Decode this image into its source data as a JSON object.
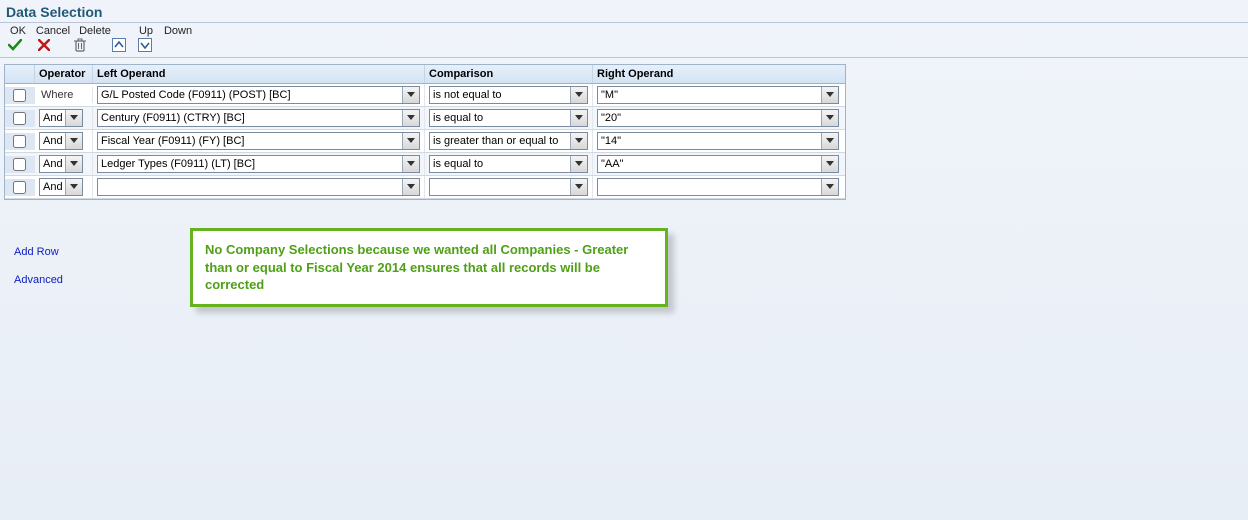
{
  "title": "Data Selection",
  "toolbar": {
    "ok": "OK",
    "cancel": "Cancel",
    "delete": "Delete",
    "up": "Up",
    "down": "Down"
  },
  "headers": {
    "operator": "Operator",
    "left": "Left Operand",
    "comparison": "Comparison",
    "right": "Right Operand"
  },
  "rows": [
    {
      "operator_text": "Where",
      "operator_is_select": false,
      "left": "G/L Posted Code (F0911) (POST) [BC]",
      "comparison": "is not equal to",
      "right": "\"M\""
    },
    {
      "operator_text": "And",
      "operator_is_select": true,
      "left": "Century (F0911) (CTRY) [BC]",
      "comparison": "is equal to",
      "right": "\"20\""
    },
    {
      "operator_text": "And",
      "operator_is_select": true,
      "left": "Fiscal Year (F0911) (FY) [BC]",
      "comparison": "is greater than or equal to",
      "right": "\"14\""
    },
    {
      "operator_text": "And",
      "operator_is_select": true,
      "left": "Ledger Types (F0911) (LT) [BC]",
      "comparison": "is equal to",
      "right": "\"AA\""
    },
    {
      "operator_text": "And",
      "operator_is_select": true,
      "left": "",
      "comparison": "",
      "right": ""
    }
  ],
  "links": {
    "addrow": "Add Row",
    "advanced": "Advanced"
  },
  "callout": "No Company Selections because we wanted all Companies  - Greater than or equal to Fiscal Year 2014 ensures that all records will be corrected"
}
